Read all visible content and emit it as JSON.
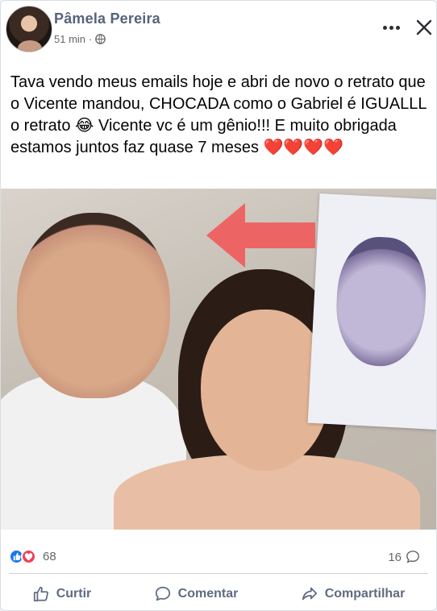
{
  "post": {
    "author": "Pâmela Pereira",
    "time": "51 min",
    "separator": "·",
    "privacy_icon": "globe-icon",
    "text": "Tava vendo meus emails hoje e abri de novo o retrato que o Vicente mandou, CHOCADA como o Gabriel é IGUALLL o retrato 😂 Vicente vc é um gênio!!! E muito obrigada estamos juntos faz quase 7 meses ❤️❤️❤️❤️"
  },
  "header_icons": {
    "more": "more-horizontal-icon",
    "close": "close-icon"
  },
  "stats": {
    "reactions_count": "68",
    "comments_count": "16",
    "reaction_types": [
      "like-icon",
      "love-icon"
    ]
  },
  "actions": [
    {
      "label": "Curtir",
      "icon": "thumbs-up-icon"
    },
    {
      "label": "Comentar",
      "icon": "comment-icon"
    },
    {
      "label": "Compartilhar",
      "icon": "share-icon"
    }
  ],
  "colors": {
    "author_name": "#55637a",
    "like_blue": "#1877f2",
    "love_red": "#f33e58",
    "arrow_red": "#f05a5a",
    "secondary_text": "#65676b"
  }
}
